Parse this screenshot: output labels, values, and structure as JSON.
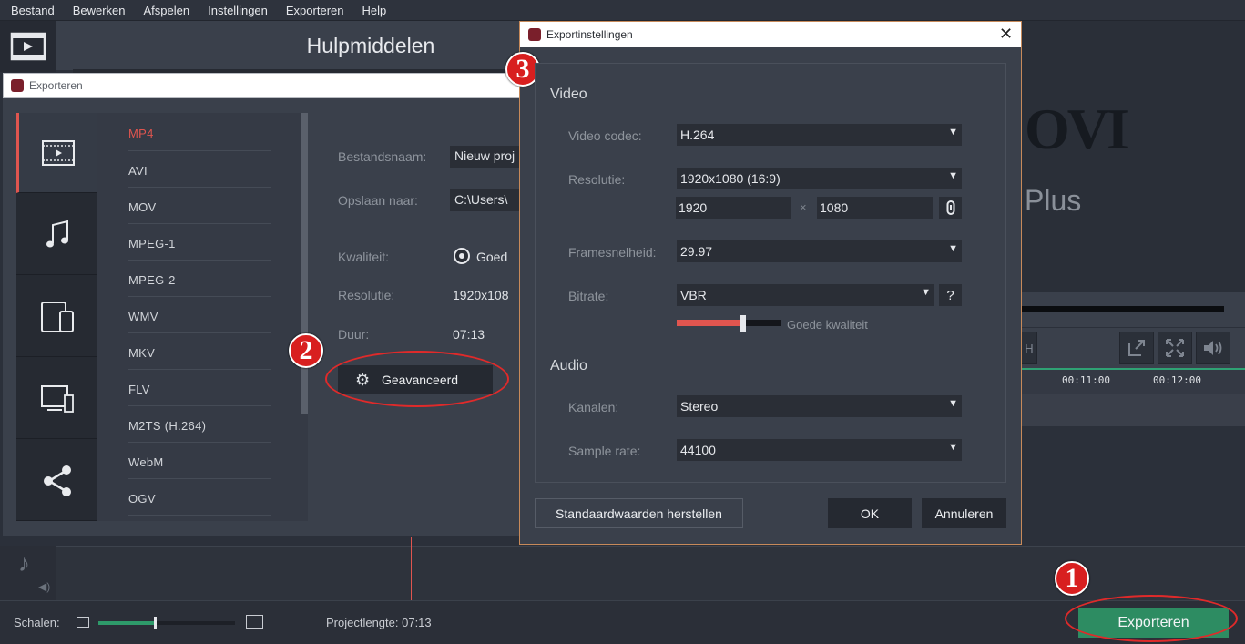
{
  "menu": [
    "Bestand",
    "Bewerken",
    "Afspelen",
    "Instellingen",
    "Exporteren",
    "Help"
  ],
  "header": {
    "title": "Hulpmiddelen"
  },
  "preview": {
    "logo_partial": "OVI",
    "plus_partial": "Plus"
  },
  "timeline": {
    "time1": "00:11:00",
    "time2": "00:12:00"
  },
  "bottom": {
    "scale_label": "Schalen:",
    "scale_value": 0.42,
    "project_length": "Projectlengte:  07:13",
    "export_button": "Exporteren"
  },
  "export_window": {
    "title": "Exporteren",
    "formats": [
      "MP4",
      "AVI",
      "MOV",
      "MPEG-1",
      "MPEG-2",
      "WMV",
      "MKV",
      "FLV",
      "M2TS (H.264)",
      "WebM",
      "OGV"
    ],
    "selected_format": "MP4",
    "filename_label": "Bestandsnaam:",
    "filename_value": "Nieuw proj",
    "save_label": "Opslaan naar:",
    "save_value": "C:\\Users\\",
    "quality_label": "Kwaliteit:",
    "quality_value": "Goed",
    "resolution_label": "Resolutie:",
    "resolution_value": "1920x108",
    "duration_label": "Duur:",
    "duration_value": "07:13",
    "advanced_button": "Geavanceerd"
  },
  "settings_dialog": {
    "title": "Exportinstellingen",
    "video_heading": "Video",
    "codec_label": "Video codec:",
    "codec_value": "H.264",
    "resolution_label": "Resolutie:",
    "resolution_value": "1920x1080 (16:9)",
    "width": "1920",
    "height": "1080",
    "times": "×",
    "framerate_label": "Framesnelheid:",
    "framerate_value": "29.97",
    "bitrate_label": "Bitrate:",
    "bitrate_value": "VBR",
    "quality_level": 0.63,
    "quality_text": "Goede kwaliteit",
    "help": "?",
    "audio_heading": "Audio",
    "channels_label": "Kanalen:",
    "channels_value": "Stereo",
    "samplerate_label": "Sample rate:",
    "samplerate_value": "44100",
    "reset_button": "Standaardwaarden herstellen",
    "ok_button": "OK",
    "cancel_button": "Annuleren"
  },
  "badges": {
    "one": "1",
    "two": "2",
    "three": "3"
  },
  "colors": {
    "accent_red": "#e0554f",
    "export_green": "#2d8c62",
    "annotation_red": "#e02a2a"
  }
}
